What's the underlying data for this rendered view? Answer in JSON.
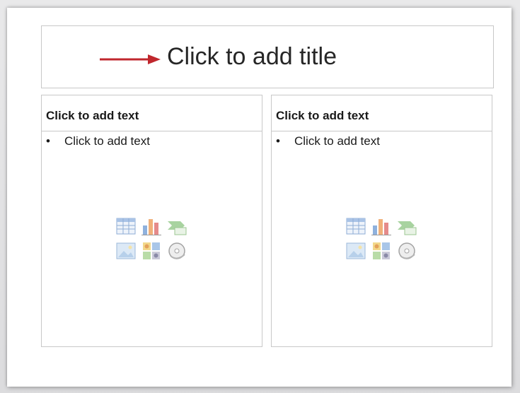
{
  "slide": {
    "title_placeholder": "Click to add title",
    "columns": [
      {
        "heading": "Click to add text",
        "bullet_marker": "•",
        "bullet_text": "Click to add text",
        "insert_icons": [
          "insert-table-icon",
          "insert-chart-icon",
          "insert-smartart-icon",
          "insert-picture-icon",
          "insert-clipart-icon",
          "insert-media-icon"
        ]
      },
      {
        "heading": "Click to add text",
        "bullet_marker": "•",
        "bullet_text": "Click to add text",
        "insert_icons": [
          "insert-table-icon",
          "insert-chart-icon",
          "insert-smartart-icon",
          "insert-picture-icon",
          "insert-clipart-icon",
          "insert-media-icon"
        ]
      }
    ]
  },
  "colors": {
    "arrow": "#c0272d",
    "border": "#c8c8c8",
    "text": "#262626"
  }
}
